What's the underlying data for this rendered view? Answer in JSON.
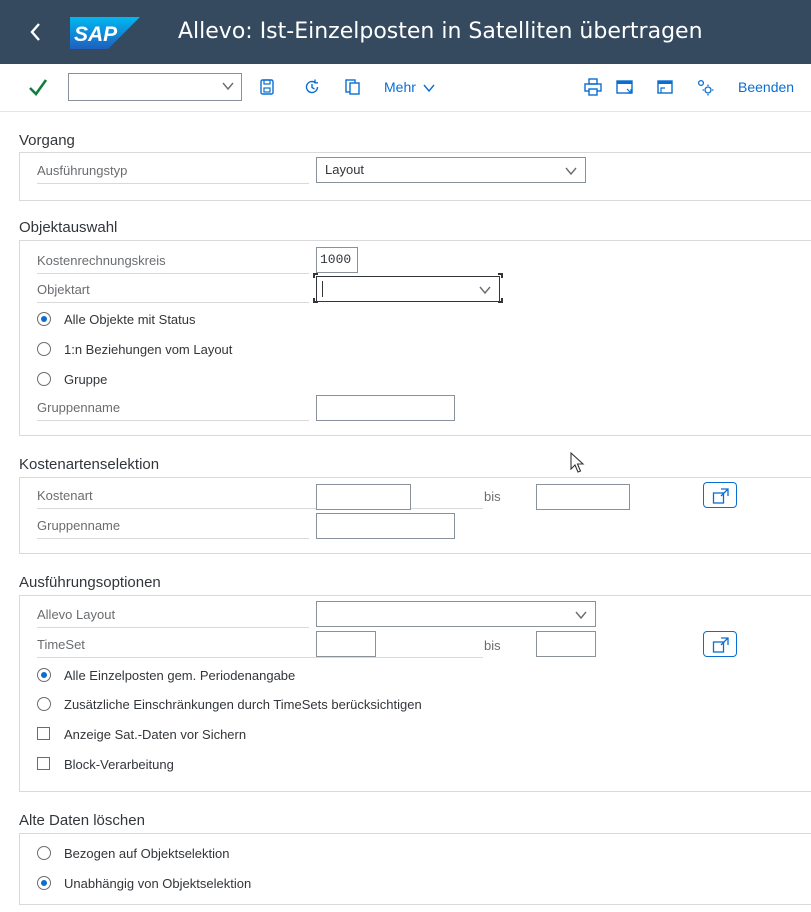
{
  "titlebar": {
    "back_icon": "chevron-left-icon",
    "logo_text": "SAP",
    "title": "Allevo: Ist-Einzelposten in Satelliten übertragen",
    "background": "#354a5f"
  },
  "toolbar": {
    "execute_icon": "checkmark-icon",
    "variant_value": "",
    "icons": [
      "save-icon",
      "history-icon",
      "copy-icon"
    ],
    "more_label": "Mehr",
    "right_icons": [
      "print-icon",
      "window-icon",
      "new-window-icon",
      "settings-icon"
    ],
    "exit_label": "Beenden"
  },
  "vorgang": {
    "title": "Vorgang",
    "ausfuehrungstyp_label": "Ausführungstyp",
    "ausfuehrungstyp_value": "Layout"
  },
  "objektauswahl": {
    "title": "Objektauswahl",
    "kostenrechnungskreis_label": "Kostenrechnungskreis",
    "kostenrechnungskreis_value": "1000",
    "objektart_label": "Objektart",
    "objektart_value": "",
    "radio_1": "Alle Objekte mit Status",
    "radio_2": "1:n Beziehungen vom Layout",
    "radio_3": "Gruppe",
    "selected_radio": 1,
    "gruppenname_label": "Gruppenname",
    "gruppenname_value": ""
  },
  "kostenarten": {
    "title": "Kostenartenselektion",
    "kostenart_label": "Kostenart",
    "kostenart_from": "",
    "bis_label": "bis",
    "kostenart_to": "",
    "gruppenname_label": "Gruppenname",
    "gruppenname_value": ""
  },
  "optionen": {
    "title": "Ausführungsoptionen",
    "layout_label": "Allevo Layout",
    "layout_value": "",
    "timeset_label": "TimeSet",
    "timeset_from": "",
    "bis_label": "bis",
    "timeset_to": "",
    "radio_1": "Alle Einzelposten gem. Periodenangabe",
    "radio_2": "Zusätzliche Einschränkungen durch TimeSets berücksichtigen",
    "selected_radio": 1,
    "check_1": "Anzeige Sat.-Daten vor Sichern",
    "check_1_checked": false,
    "check_2": "Block-Verarbeitung",
    "check_2_checked": false
  },
  "loeschen": {
    "title": "Alte Daten löschen",
    "radio_1": "Bezogen auf Objektselektion",
    "radio_2": "Unabhängig von Objektselektion",
    "selected_radio": 2
  },
  "colors": {
    "accent": "#0a6ed1",
    "positive": "#107e3e",
    "logo_blue": "#1a8fd8"
  }
}
